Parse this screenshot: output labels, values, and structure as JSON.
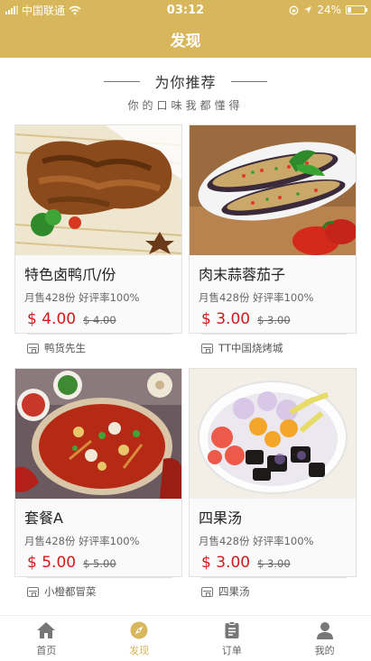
{
  "status_bar": {
    "carrier": "中国联通",
    "time": "03:12",
    "battery": "24%",
    "battery_level": 0.24,
    "icons": [
      "signal-icon",
      "wifi-icon",
      "lock-rotation-icon",
      "location-icon",
      "battery-icon"
    ]
  },
  "nav": {
    "title": "发现"
  },
  "section": {
    "title": "为你推荐",
    "subtitle": "你的口味我都懂得"
  },
  "items": [
    {
      "name": "特色卤鸭爪/份",
      "stats": "月售428份 好评率100%",
      "price": "$ 4.00",
      "original_price": "$ 4.00",
      "shop": "鸭货先生"
    },
    {
      "name": "肉末蒜蓉茄子",
      "stats": "月售428份 好评率100%",
      "price": "$ 3.00",
      "original_price": "$ 3.00",
      "shop": "TT中国烧烤城"
    },
    {
      "name": "套餐A",
      "stats": "月售428份 好评率100%",
      "price": "$ 5.00",
      "original_price": "$ 5.00",
      "shop": "小橙都冒菜"
    },
    {
      "name": "四果汤",
      "stats": "月售428份 好评率100%",
      "price": "$ 3.00",
      "original_price": "$ 3.00",
      "shop": "四果汤"
    }
  ],
  "tabs": [
    {
      "label": "首页",
      "icon": "home-icon",
      "active": false
    },
    {
      "label": "发现",
      "icon": "discover-icon",
      "active": true
    },
    {
      "label": "订单",
      "icon": "order-icon",
      "active": false
    },
    {
      "label": "我的",
      "icon": "profile-icon",
      "active": false
    }
  ],
  "colors": {
    "brand": "#d8b65b",
    "price": "#d11a1a"
  }
}
